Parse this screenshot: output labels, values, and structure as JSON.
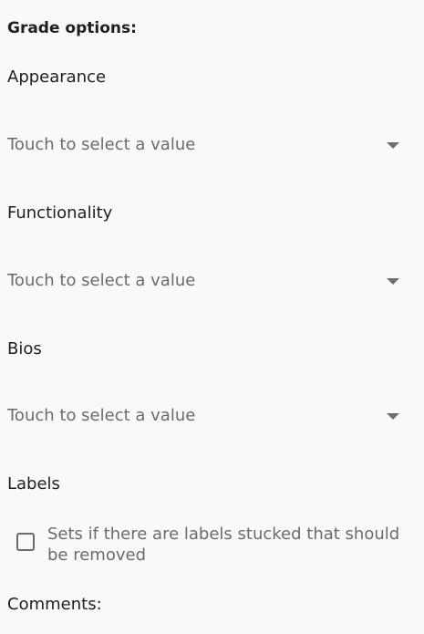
{
  "form": {
    "heading": "Grade options:",
    "sections": [
      {
        "label": "Appearance",
        "placeholder": "Touch to select a value"
      },
      {
        "label": "Functionality",
        "placeholder": "Touch to select a value"
      },
      {
        "label": "Bios",
        "placeholder": "Touch to select a value"
      }
    ],
    "labels_title": "Labels",
    "labels_checkbox_text": "Sets if there are labels stucked that should be removed",
    "labels_checked": false,
    "comments_label": "Comments:"
  },
  "icons": {
    "dropdown": "caret-down-icon",
    "checkbox": "checkbox-unchecked-icon"
  },
  "colors": {
    "background": "#f9f9fa",
    "text": "#1f1f1f",
    "placeholder": "#6b6b6b"
  }
}
